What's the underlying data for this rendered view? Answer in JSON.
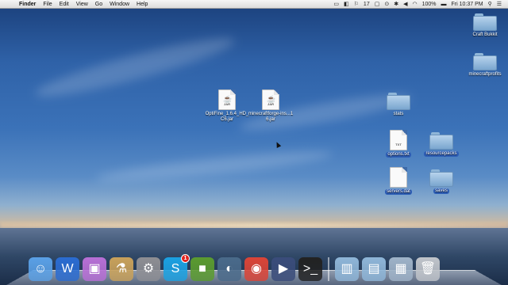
{
  "menubar": {
    "apple_glyph": "",
    "app_name": "Finder",
    "menus": [
      "File",
      "Edit",
      "View",
      "Go",
      "Window",
      "Help"
    ],
    "status_icons": [
      "status-icon-a",
      "status-icon-b",
      "status-icon-c",
      "volume-icon",
      "wifi-icon",
      "battery-icon",
      "spotlight-icon",
      "list-icon"
    ],
    "notification_count": "17",
    "battery": "100%",
    "clock": "Fri 10:37 PM"
  },
  "desktop": {
    "files": [
      {
        "label": "OptiFine_1.6.4_HD_C6.jar",
        "type": "jar",
        "tag": "JAR"
      },
      {
        "label": "minecraftforge-ins...16.jar",
        "type": "jar",
        "tag": "JAR"
      },
      {
        "label": "Craft Bukkit",
        "type": "folder"
      },
      {
        "label": "minecraftprofits",
        "type": "folder"
      },
      {
        "label": "stats",
        "type": "folder"
      },
      {
        "label": "options.txt",
        "type": "doc",
        "tag": "TXT"
      },
      {
        "label": "resourcepacks",
        "type": "folder"
      },
      {
        "label": "servers.dat",
        "type": "doc"
      },
      {
        "label": "saves",
        "type": "folder"
      }
    ]
  },
  "dock": {
    "apps": [
      {
        "name": "finder-icon",
        "glyph": "☺",
        "color": "#5aa0e6"
      },
      {
        "name": "word-icon",
        "glyph": "W",
        "color": "#2b6cd1"
      },
      {
        "name": "system-icon",
        "glyph": "▣",
        "color": "#b86fd6"
      },
      {
        "name": "preview-icon",
        "glyph": "⚗",
        "color": "#c9a15a"
      },
      {
        "name": "system-preferences-icon",
        "glyph": "⚙",
        "color": "#8e8e93"
      },
      {
        "name": "skype-icon",
        "glyph": "S",
        "color": "#1ba1e2",
        "badge": "1"
      },
      {
        "name": "minecraft-icon",
        "glyph": "■",
        "color": "#5b9b2f"
      },
      {
        "name": "steam-icon",
        "glyph": "◐",
        "color": "#4a6a8a"
      },
      {
        "name": "chrome-icon",
        "glyph": "◉",
        "color": "#db4437"
      },
      {
        "name": "video-icon",
        "glyph": "▶",
        "color": "#3a4c7a"
      },
      {
        "name": "terminal-icon",
        "glyph": ">_",
        "color": "#222222"
      }
    ],
    "stacks": [
      {
        "name": "applications-folder-icon",
        "glyph": "▥",
        "color": "#8fb6d8"
      },
      {
        "name": "documents-folder-icon",
        "glyph": "▤",
        "color": "#8fb6d8"
      },
      {
        "name": "downloads-stack-icon",
        "glyph": "▦",
        "color": "#9fb3c8"
      },
      {
        "name": "trash-icon",
        "glyph": "🗑",
        "color": "#c0c4ca"
      }
    ]
  }
}
